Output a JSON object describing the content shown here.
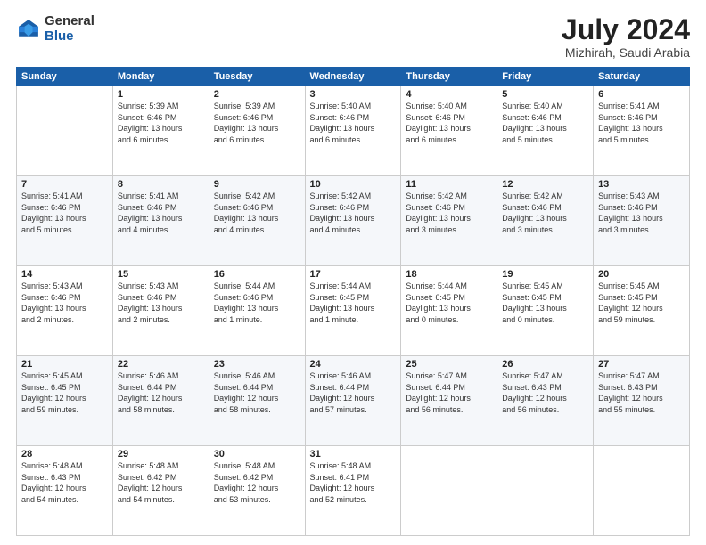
{
  "header": {
    "logo_general": "General",
    "logo_blue": "Blue",
    "month_title": "July 2024",
    "location": "Mizhirah, Saudi Arabia"
  },
  "columns": [
    "Sunday",
    "Monday",
    "Tuesday",
    "Wednesday",
    "Thursday",
    "Friday",
    "Saturday"
  ],
  "weeks": [
    [
      {
        "day": "",
        "info": ""
      },
      {
        "day": "1",
        "info": "Sunrise: 5:39 AM\nSunset: 6:46 PM\nDaylight: 13 hours\nand 6 minutes."
      },
      {
        "day": "2",
        "info": "Sunrise: 5:39 AM\nSunset: 6:46 PM\nDaylight: 13 hours\nand 6 minutes."
      },
      {
        "day": "3",
        "info": "Sunrise: 5:40 AM\nSunset: 6:46 PM\nDaylight: 13 hours\nand 6 minutes."
      },
      {
        "day": "4",
        "info": "Sunrise: 5:40 AM\nSunset: 6:46 PM\nDaylight: 13 hours\nand 6 minutes."
      },
      {
        "day": "5",
        "info": "Sunrise: 5:40 AM\nSunset: 6:46 PM\nDaylight: 13 hours\nand 5 minutes."
      },
      {
        "day": "6",
        "info": "Sunrise: 5:41 AM\nSunset: 6:46 PM\nDaylight: 13 hours\nand 5 minutes."
      }
    ],
    [
      {
        "day": "7",
        "info": "Sunrise: 5:41 AM\nSunset: 6:46 PM\nDaylight: 13 hours\nand 5 minutes."
      },
      {
        "day": "8",
        "info": "Sunrise: 5:41 AM\nSunset: 6:46 PM\nDaylight: 13 hours\nand 4 minutes."
      },
      {
        "day": "9",
        "info": "Sunrise: 5:42 AM\nSunset: 6:46 PM\nDaylight: 13 hours\nand 4 minutes."
      },
      {
        "day": "10",
        "info": "Sunrise: 5:42 AM\nSunset: 6:46 PM\nDaylight: 13 hours\nand 4 minutes."
      },
      {
        "day": "11",
        "info": "Sunrise: 5:42 AM\nSunset: 6:46 PM\nDaylight: 13 hours\nand 3 minutes."
      },
      {
        "day": "12",
        "info": "Sunrise: 5:42 AM\nSunset: 6:46 PM\nDaylight: 13 hours\nand 3 minutes."
      },
      {
        "day": "13",
        "info": "Sunrise: 5:43 AM\nSunset: 6:46 PM\nDaylight: 13 hours\nand 3 minutes."
      }
    ],
    [
      {
        "day": "14",
        "info": "Sunrise: 5:43 AM\nSunset: 6:46 PM\nDaylight: 13 hours\nand 2 minutes."
      },
      {
        "day": "15",
        "info": "Sunrise: 5:43 AM\nSunset: 6:46 PM\nDaylight: 13 hours\nand 2 minutes."
      },
      {
        "day": "16",
        "info": "Sunrise: 5:44 AM\nSunset: 6:46 PM\nDaylight: 13 hours\nand 1 minute."
      },
      {
        "day": "17",
        "info": "Sunrise: 5:44 AM\nSunset: 6:45 PM\nDaylight: 13 hours\nand 1 minute."
      },
      {
        "day": "18",
        "info": "Sunrise: 5:44 AM\nSunset: 6:45 PM\nDaylight: 13 hours\nand 0 minutes."
      },
      {
        "day": "19",
        "info": "Sunrise: 5:45 AM\nSunset: 6:45 PM\nDaylight: 13 hours\nand 0 minutes."
      },
      {
        "day": "20",
        "info": "Sunrise: 5:45 AM\nSunset: 6:45 PM\nDaylight: 12 hours\nand 59 minutes."
      }
    ],
    [
      {
        "day": "21",
        "info": "Sunrise: 5:45 AM\nSunset: 6:45 PM\nDaylight: 12 hours\nand 59 minutes."
      },
      {
        "day": "22",
        "info": "Sunrise: 5:46 AM\nSunset: 6:44 PM\nDaylight: 12 hours\nand 58 minutes."
      },
      {
        "day": "23",
        "info": "Sunrise: 5:46 AM\nSunset: 6:44 PM\nDaylight: 12 hours\nand 58 minutes."
      },
      {
        "day": "24",
        "info": "Sunrise: 5:46 AM\nSunset: 6:44 PM\nDaylight: 12 hours\nand 57 minutes."
      },
      {
        "day": "25",
        "info": "Sunrise: 5:47 AM\nSunset: 6:44 PM\nDaylight: 12 hours\nand 56 minutes."
      },
      {
        "day": "26",
        "info": "Sunrise: 5:47 AM\nSunset: 6:43 PM\nDaylight: 12 hours\nand 56 minutes."
      },
      {
        "day": "27",
        "info": "Sunrise: 5:47 AM\nSunset: 6:43 PM\nDaylight: 12 hours\nand 55 minutes."
      }
    ],
    [
      {
        "day": "28",
        "info": "Sunrise: 5:48 AM\nSunset: 6:43 PM\nDaylight: 12 hours\nand 54 minutes."
      },
      {
        "day": "29",
        "info": "Sunrise: 5:48 AM\nSunset: 6:42 PM\nDaylight: 12 hours\nand 54 minutes."
      },
      {
        "day": "30",
        "info": "Sunrise: 5:48 AM\nSunset: 6:42 PM\nDaylight: 12 hours\nand 53 minutes."
      },
      {
        "day": "31",
        "info": "Sunrise: 5:48 AM\nSunset: 6:41 PM\nDaylight: 12 hours\nand 52 minutes."
      },
      {
        "day": "",
        "info": ""
      },
      {
        "day": "",
        "info": ""
      },
      {
        "day": "",
        "info": ""
      }
    ]
  ]
}
